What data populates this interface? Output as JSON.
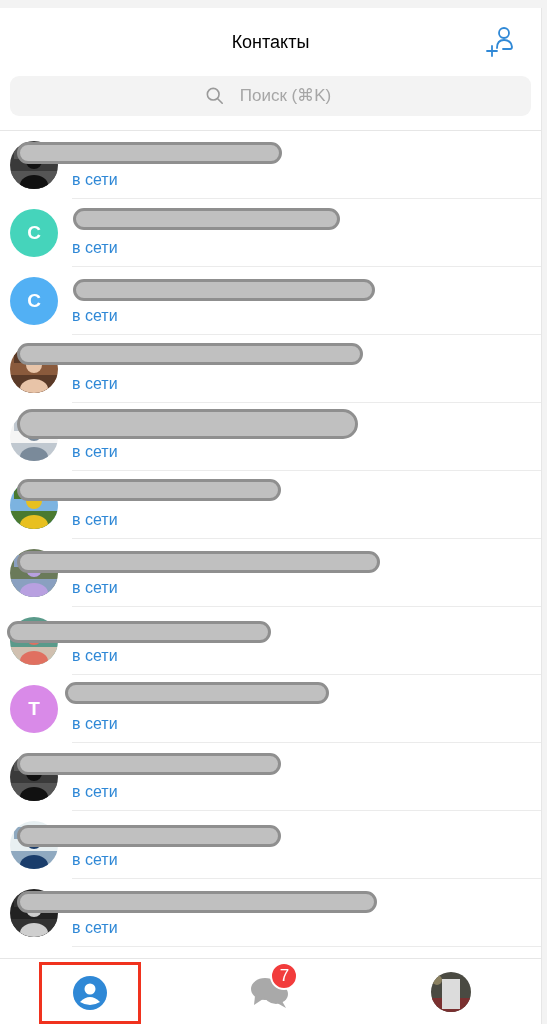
{
  "header": {
    "title": "Контакты"
  },
  "search": {
    "placeholder": "Поиск (⌘K)"
  },
  "contacts": [
    {
      "status": "в сети"
    },
    {
      "kind": "letter",
      "initial": "С",
      "color": "#45d4bb",
      "status": "в сети"
    },
    {
      "kind": "letter",
      "initial": "С",
      "color": "#52b0f4",
      "status": "в сети"
    },
    {
      "status": "в сети"
    },
    {
      "status": "в сети"
    },
    {
      "status": "в сети"
    },
    {
      "status": "в сети"
    },
    {
      "status": "в сети"
    },
    {
      "kind": "letter",
      "initial": "Т",
      "color": "#d98ae8",
      "status": "в сети"
    },
    {
      "status": "в сети"
    },
    {
      "status": "в сети"
    },
    {
      "status": "в сети"
    }
  ],
  "tabs": [
    {
      "kind": "contacts",
      "selected": true
    },
    {
      "kind": "chats",
      "selected": false,
      "badge": "7"
    },
    {
      "kind": "profile",
      "selected": false
    }
  ]
}
